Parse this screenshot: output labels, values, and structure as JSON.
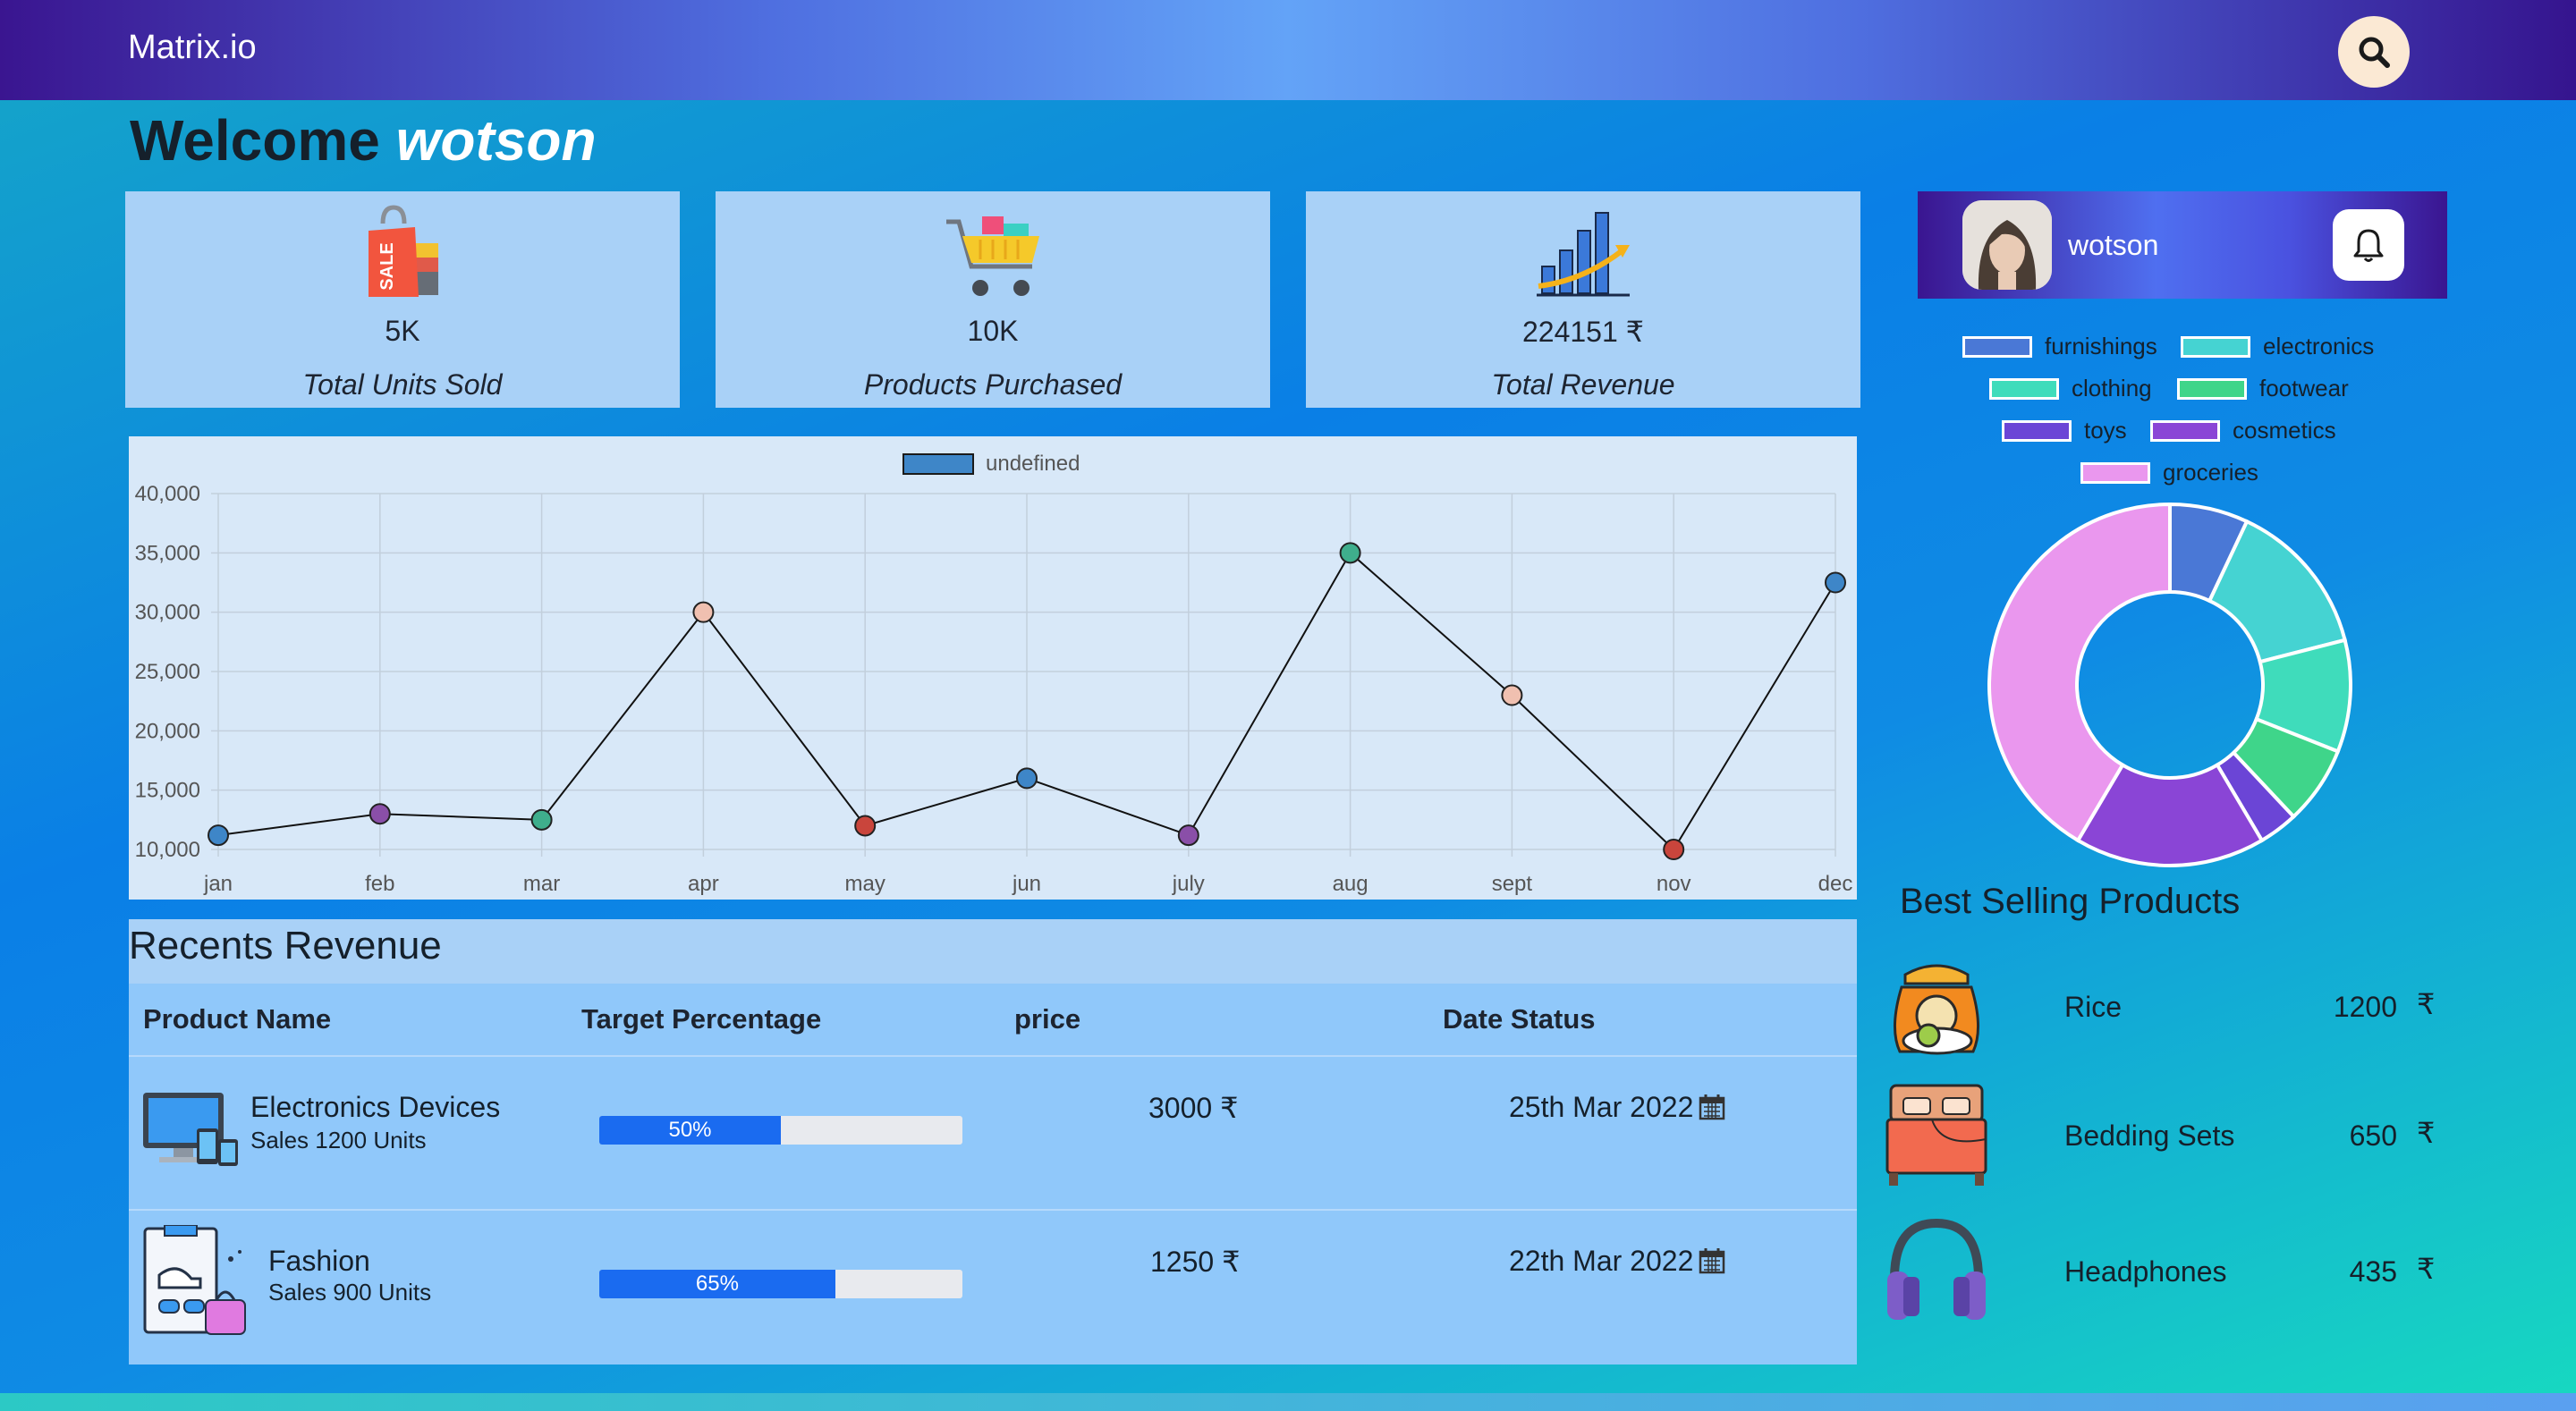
{
  "app": {
    "brand": "Matrix.io"
  },
  "header": {
    "welcome": "Welcome",
    "user": "wotson"
  },
  "cards": [
    {
      "value": "5K",
      "label": "Total Units Sold",
      "icon": "shopping-bag-sale-icon"
    },
    {
      "value": "10K",
      "label": "Products Purchased",
      "icon": "shopping-cart-icon"
    },
    {
      "value": "224151 ₹",
      "label": "Total Revenue",
      "icon": "growth-chart-icon"
    }
  ],
  "chart_data": {
    "type": "line",
    "legend": "undefined",
    "categories": [
      "jan",
      "feb",
      "mar",
      "apr",
      "may",
      "jun",
      "july",
      "aug",
      "sept",
      "nov",
      "dec"
    ],
    "values": [
      11200,
      13000,
      12500,
      30000,
      12000,
      16000,
      11200,
      35000,
      23000,
      10000,
      32500
    ],
    "ylim": [
      10000,
      40000
    ],
    "yticks": [
      "40,000",
      "35,000",
      "30,000",
      "25,000",
      "20,000",
      "15,000",
      "10,000"
    ],
    "point_colors": [
      "#3e86c8",
      "#8a4fa8",
      "#3fae8c",
      "#f0c0b0",
      "#c9453c",
      "#3e86c8",
      "#8a4fa8",
      "#3fae8c",
      "#f0c0b0",
      "#c9453c",
      "#3e86c8"
    ],
    "grid": true
  },
  "revenue": {
    "title": "Recents Revenue",
    "columns": [
      "Product Name",
      "Target Percentage",
      "price",
      "Date Status"
    ],
    "rows": [
      {
        "name": "Electronics Devices",
        "sub": "Sales 1200 Units",
        "target": 50,
        "target_label": "50%",
        "price": "3000 ₹",
        "date": "25th Mar 2022",
        "icon": "computer-devices-icon"
      },
      {
        "name": "Fashion",
        "sub": "Sales 900 Units",
        "target": 65,
        "target_label": "65%",
        "price": "1250 ₹",
        "date": "22th Mar 2022",
        "icon": "fashion-checklist-icon"
      }
    ]
  },
  "profile": {
    "name": "wotson"
  },
  "donut": {
    "legend": [
      {
        "label": "furnishings",
        "color": "#4a78d6"
      },
      {
        "label": "electronics",
        "color": "#45d3d2"
      },
      {
        "label": "clothing",
        "color": "#3fdcbb"
      },
      {
        "label": "footwear",
        "color": "#3fd58a"
      },
      {
        "label": "toys",
        "color": "#6b45d6"
      },
      {
        "label": "cosmetics",
        "color": "#8a45d6"
      },
      {
        "label": "groceries",
        "color": "#ea97ee"
      }
    ],
    "values": [
      7,
      14,
      10,
      7,
      3.5,
      17,
      41.5
    ]
  },
  "best_selling": {
    "title": "Best Selling Products",
    "items": [
      {
        "name": "Rice",
        "price": "1200",
        "currency": "₹",
        "icon": "rice-sack-icon"
      },
      {
        "name": "Bedding Sets",
        "price": "650",
        "currency": "₹",
        "icon": "bed-icon"
      },
      {
        "name": "Headphones",
        "price": "435",
        "currency": "₹",
        "icon": "headphones-icon"
      }
    ]
  }
}
